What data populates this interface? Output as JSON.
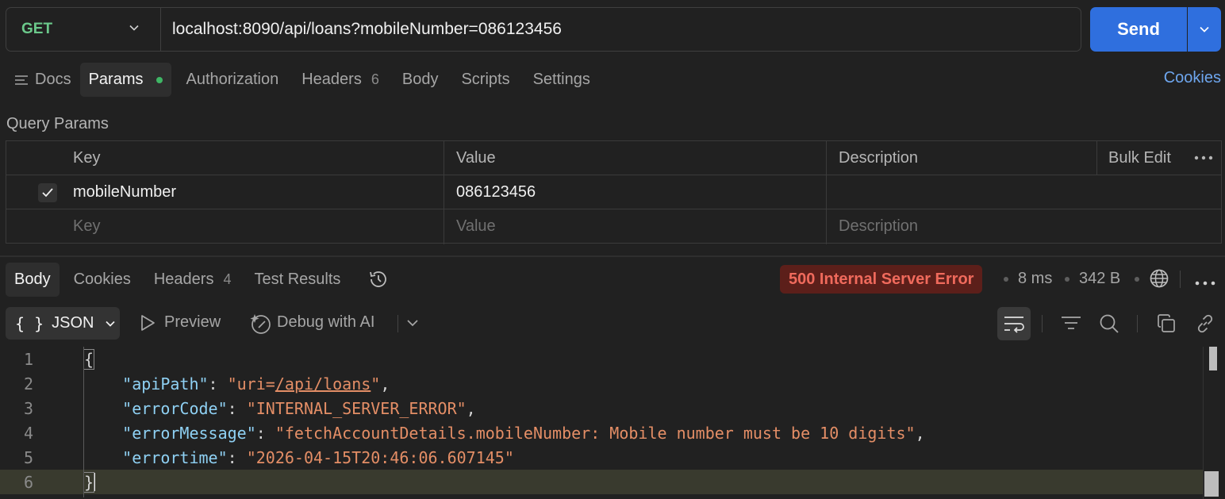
{
  "request": {
    "method": "GET",
    "url": "localhost:8090/api/loans?mobileNumber=086123456",
    "send_label": "Send"
  },
  "request_tabs": {
    "docs": "Docs",
    "params": "Params",
    "authorization": "Authorization",
    "headers": "Headers",
    "headers_count": "6",
    "body": "Body",
    "scripts": "Scripts",
    "settings": "Settings",
    "cookies": "Cookies"
  },
  "query_params": {
    "title": "Query Params",
    "headers": {
      "key": "Key",
      "value": "Value",
      "description": "Description",
      "bulk_edit": "Bulk Edit"
    },
    "rows": [
      {
        "checked": true,
        "key": "mobileNumber",
        "value": "086123456",
        "description": ""
      }
    ],
    "placeholders": {
      "key": "Key",
      "value": "Value",
      "description": "Description"
    }
  },
  "response_tabs": {
    "body": "Body",
    "cookies": "Cookies",
    "headers": "Headers",
    "headers_count": "4",
    "test_results": "Test Results"
  },
  "response_meta": {
    "status": "500 Internal Server Error",
    "time": "8 ms",
    "size": "342 B",
    "status_color": "#f06a5c"
  },
  "response_toolbar": {
    "format": "JSON",
    "format_icon": "{ }",
    "preview": "Preview",
    "debug_ai": "Debug with AI"
  },
  "response_body": {
    "line_numbers": [
      "1",
      "2",
      "3",
      "4",
      "5",
      "6"
    ],
    "open_brace": "{",
    "close_brace": "}",
    "fields": [
      {
        "key": "\"apiPath\"",
        "value_prefix": "\"uri=",
        "value_link": "/api/loans",
        "value_suffix": "\"",
        "trail": ","
      },
      {
        "key": "\"errorCode\"",
        "value": "\"INTERNAL_SERVER_ERROR\"",
        "trail": ","
      },
      {
        "key": "\"errorMessage\"",
        "value": "\"fetchAccountDetails.mobileNumber: Mobile number must be 10 digits\"",
        "trail": ","
      },
      {
        "key": "\"errortime\"",
        "value": "\"2026-04-15T20:46:06.607145\"",
        "trail": ""
      }
    ]
  },
  "colors": {
    "accent_blue": "#2f6fde",
    "method_green": "#6bc98b",
    "json_key": "#8fd1f4",
    "json_string": "#e48e66"
  }
}
